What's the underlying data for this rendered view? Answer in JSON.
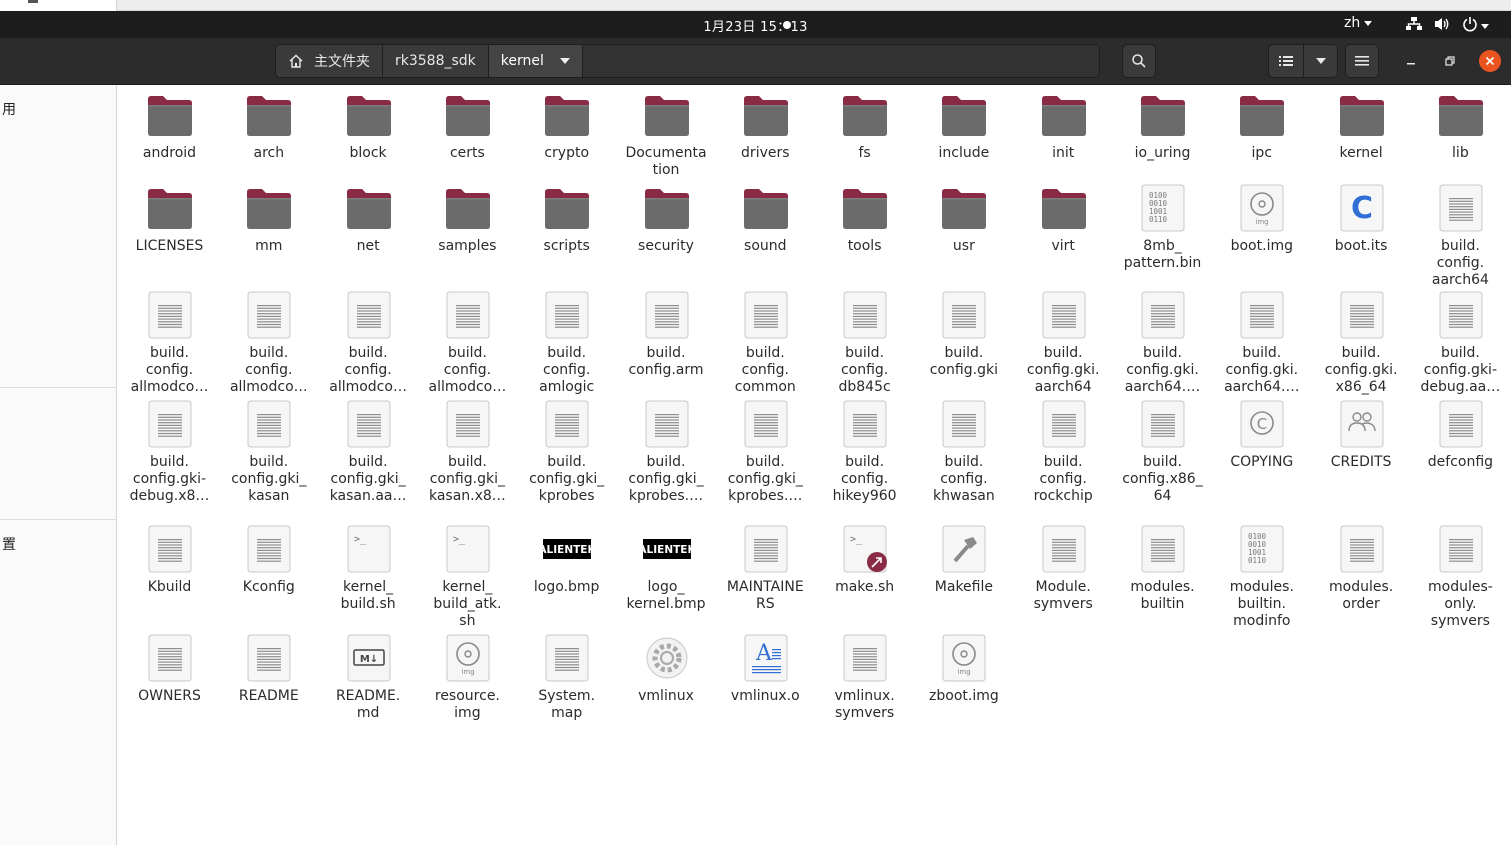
{
  "topbar": {
    "clock": "1月23日 15：13",
    "lang": "zh"
  },
  "headerbar": {
    "breadcrumbs": [
      "主文件夹",
      "rk3588_sdk",
      "kernel"
    ]
  },
  "sidebar": {
    "items": [
      "用",
      "置"
    ]
  },
  "colors": {
    "folder_top": "#8a2b45",
    "folder_body": "#6b6b6b",
    "close_button": "#e95420",
    "topbar": "#1d1d1d",
    "headerbar": "#2c2c2c"
  },
  "files": [
    {
      "label": "android",
      "icon": "folder"
    },
    {
      "label": "arch",
      "icon": "folder"
    },
    {
      "label": "block",
      "icon": "folder"
    },
    {
      "label": "certs",
      "icon": "folder"
    },
    {
      "label": "crypto",
      "icon": "folder"
    },
    {
      "label": "Documenta\ntion",
      "icon": "folder"
    },
    {
      "label": "drivers",
      "icon": "folder"
    },
    {
      "label": "fs",
      "icon": "folder"
    },
    {
      "label": "include",
      "icon": "folder"
    },
    {
      "label": "init",
      "icon": "folder"
    },
    {
      "label": "io_uring",
      "icon": "folder"
    },
    {
      "label": "ipc",
      "icon": "folder"
    },
    {
      "label": "kernel",
      "icon": "folder"
    },
    {
      "label": "lib",
      "icon": "folder"
    },
    {
      "label": "LICENSES",
      "icon": "folder"
    },
    {
      "label": "mm",
      "icon": "folder"
    },
    {
      "label": "net",
      "icon": "folder"
    },
    {
      "label": "samples",
      "icon": "folder"
    },
    {
      "label": "scripts",
      "icon": "folder"
    },
    {
      "label": "security",
      "icon": "folder"
    },
    {
      "label": "sound",
      "icon": "folder"
    },
    {
      "label": "tools",
      "icon": "folder"
    },
    {
      "label": "usr",
      "icon": "folder"
    },
    {
      "label": "virt",
      "icon": "folder"
    },
    {
      "label": "8mb_\npattern.bin",
      "icon": "binary"
    },
    {
      "label": "boot.img",
      "icon": "disc"
    },
    {
      "label": "boot.its",
      "icon": "c-source"
    },
    {
      "label": "build.\nconfig.\naarch64",
      "icon": "text"
    },
    {
      "label": "build.\nconfig.\nallmodco…",
      "icon": "text"
    },
    {
      "label": "build.\nconfig.\nallmodco…",
      "icon": "text"
    },
    {
      "label": "build.\nconfig.\nallmodco…",
      "icon": "text"
    },
    {
      "label": "build.\nconfig.\nallmodco…",
      "icon": "text"
    },
    {
      "label": "build.\nconfig.\namlogic",
      "icon": "text"
    },
    {
      "label": "build.\nconfig.arm",
      "icon": "text"
    },
    {
      "label": "build.\nconfig.\ncommon",
      "icon": "text"
    },
    {
      "label": "build.\nconfig.\ndb845c",
      "icon": "text"
    },
    {
      "label": "build.\nconfig.gki",
      "icon": "text"
    },
    {
      "label": "build.\nconfig.gki.\naarch64",
      "icon": "text"
    },
    {
      "label": "build.\nconfig.gki.\naarch64.…",
      "icon": "text"
    },
    {
      "label": "build.\nconfig.gki.\naarch64.…",
      "icon": "text"
    },
    {
      "label": "build.\nconfig.gki.\nx86_64",
      "icon": "text"
    },
    {
      "label": "build.\nconfig.gki-\ndebug.aa…",
      "icon": "text"
    },
    {
      "label": "build.\nconfig.gki-\ndebug.x8…",
      "icon": "text"
    },
    {
      "label": "build.\nconfig.gki_\nkasan",
      "icon": "text"
    },
    {
      "label": "build.\nconfig.gki_\nkasan.aa…",
      "icon": "text"
    },
    {
      "label": "build.\nconfig.gki_\nkasan.x8…",
      "icon": "text"
    },
    {
      "label": "build.\nconfig.gki_\nkprobes",
      "icon": "text"
    },
    {
      "label": "build.\nconfig.gki_\nkprobes.…",
      "icon": "text"
    },
    {
      "label": "build.\nconfig.gki_\nkprobes.…",
      "icon": "text"
    },
    {
      "label": "build.\nconfig.\nhikey960",
      "icon": "text"
    },
    {
      "label": "build.\nconfig.\nkhwasan",
      "icon": "text"
    },
    {
      "label": "build.\nconfig.\nrockchip",
      "icon": "text"
    },
    {
      "label": "build.\nconfig.x86_\n64",
      "icon": "text"
    },
    {
      "label": "COPYING",
      "icon": "copyright"
    },
    {
      "label": "CREDITS",
      "icon": "people"
    },
    {
      "label": "defconfig",
      "icon": "text"
    },
    {
      "label": "Kbuild",
      "icon": "text"
    },
    {
      "label": "Kconfig",
      "icon": "text"
    },
    {
      "label": "kernel_\nbuild.sh",
      "icon": "script"
    },
    {
      "label": "kernel_\nbuild_atk.\nsh",
      "icon": "script"
    },
    {
      "label": "logo.bmp",
      "icon": "logo-image",
      "thumb_text": "ALIENTEK"
    },
    {
      "label": "logo_\nkernel.bmp",
      "icon": "logo-image",
      "thumb_text": "ALIENTEK"
    },
    {
      "label": "MAINTAINE\nRS",
      "icon": "text"
    },
    {
      "label": "make.sh",
      "icon": "script-link"
    },
    {
      "label": "Makefile",
      "icon": "makefile"
    },
    {
      "label": "Module.\nsymvers",
      "icon": "text"
    },
    {
      "label": "modules.\nbuiltin",
      "icon": "text"
    },
    {
      "label": "modules.\nbuiltin.\nmodinfo",
      "icon": "binary"
    },
    {
      "label": "modules.\norder",
      "icon": "text"
    },
    {
      "label": "modules-\nonly.\nsymvers",
      "icon": "text"
    },
    {
      "label": "OWNERS",
      "icon": "text"
    },
    {
      "label": "README",
      "icon": "text"
    },
    {
      "label": "README.\nmd",
      "icon": "markdown"
    },
    {
      "label": "resource.\nimg",
      "icon": "disc"
    },
    {
      "label": "System.\nmap",
      "icon": "text"
    },
    {
      "label": "vmlinux",
      "icon": "executable"
    },
    {
      "label": "vmlinux.o",
      "icon": "font-doc"
    },
    {
      "label": "vmlinux.\nsymvers",
      "icon": "text"
    },
    {
      "label": "zboot.img",
      "icon": "disc"
    }
  ]
}
